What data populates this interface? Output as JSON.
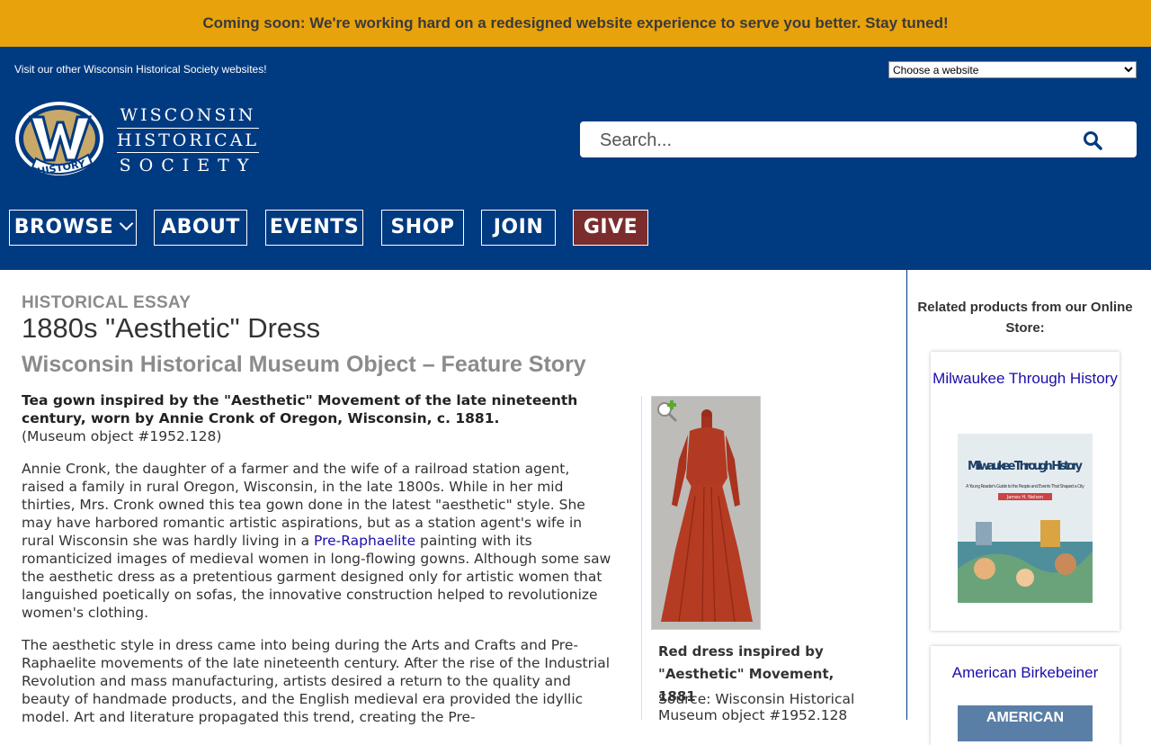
{
  "banner": {
    "text": "Coming soon: We're working hard on a redesigned website experience to serve you better. Stay tuned!"
  },
  "header": {
    "visit_text": "Visit our other Wisconsin Historical Society websites!",
    "site_select_value": "Choose a website",
    "logo_lines": [
      "WISCONSIN",
      "HISTORICAL",
      "SOCIETY"
    ],
    "logo_badge": "HISTORY",
    "search_placeholder": "Search...",
    "colors": {
      "header_bg": "#003a80",
      "banner_bg": "#e8a20c",
      "give_bg": "#7b2d2d"
    }
  },
  "nav": {
    "items": [
      {
        "label": "BROWSE",
        "dropdown": true
      },
      {
        "label": "ABOUT"
      },
      {
        "label": "EVENTS"
      },
      {
        "label": "SHOP"
      },
      {
        "label": "JOIN"
      },
      {
        "label": "GIVE"
      }
    ]
  },
  "article": {
    "eyebrow": "HISTORICAL ESSAY",
    "title": "1880s \"Aesthetic\" Dress",
    "subtitle": "Wisconsin Historical Museum Object – Feature Story",
    "lead_bold": "Tea gown inspired by the \"Aesthetic\" Movement of the late nineteenth century, worn by Annie Cronk of Oregon, Wisconsin, c. 1881.",
    "lead_object": "(Museum object #1952.128)",
    "p1_before": "Annie Cronk, the daughter of a farmer and the wife of a railroad station agent, raised a family in rural Oregon, Wisconsin, in the late 1800s. While in her mid thirties, Mrs. Cronk owned this tea gown done in the latest \"aesthetic\" style. She may have harbored romantic artistic aspirations, but as a station agent's wife in rural Wisconsin she was hardly living in a ",
    "p1_link": "Pre-Raphaelite",
    "p1_after": " painting with its romanticized images of medieval women in long-flowing gowns. Although some saw the aesthetic dress as a pretentious garment designed only for artistic women that languished poetically on sofas, the innovative construction helped to revolutionize women's clothing.",
    "p2": "The aesthetic style in dress came into being during the Arts and Crafts and Pre-Raphaelite movements of the late nineteenth century. After the rise of the Industrial Revolution and mass manufacturing, artists desired a return to the quality and beauty of handmade products, and the English medieval era provided the idyllic model. Art and literature propagated this trend, creating the Pre-"
  },
  "figure": {
    "caption": "Red dress inspired by \"Aesthetic\" Movement, 1881",
    "source": "Source: Wisconsin Historical Museum object #1952.128"
  },
  "sidebar": {
    "heading": "Related products from our Online Store:",
    "products": [
      {
        "title": "Milwaukee Through History",
        "cover_title": "Milwaukee Through History",
        "cover_sub": "A Young Reader's Guide to the People and Events That Shaped a City",
        "cover_author": "James H. Nelson"
      },
      {
        "title": "American Birkebeiner",
        "cover_title": "AMERICAN"
      }
    ]
  }
}
